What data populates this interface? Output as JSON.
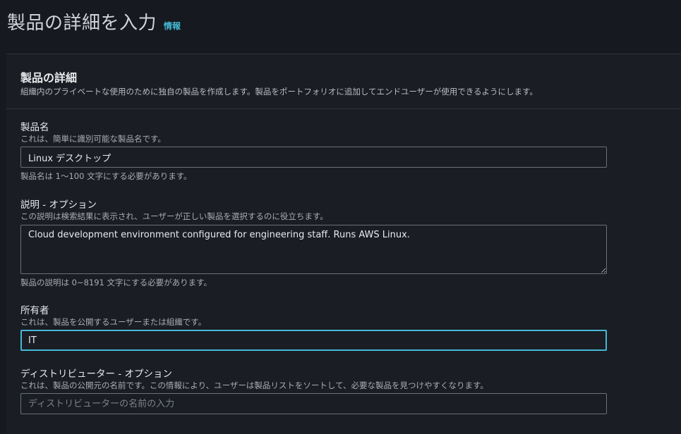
{
  "header": {
    "title": "製品の詳細を入力",
    "info_link": "情報"
  },
  "section": {
    "title": "製品の詳細",
    "description": "組織内のプライベートな使用のために独自の製品を作成します。製品をポートフォリオに追加してエンドユーザーが使用できるようにします。"
  },
  "fields": {
    "product_name": {
      "label": "製品名",
      "description": "これは、簡単に識別可能な製品名です。",
      "value": "Linux デスクトップ",
      "constraint": "製品名は 1～100 文字にする必要があります。"
    },
    "description": {
      "label": "説明 - オプション",
      "description": "この説明は検索結果に表示され、ユーザーが正しい製品を選択するのに役立ちます。",
      "value": "Cloud development environment configured for engineering staff. Runs AWS Linux.",
      "constraint": "製品の説明は 0~8191 文字にする必要があります。"
    },
    "owner": {
      "label": "所有者",
      "description": "これは、製品を公開するユーザーまたは組織です。",
      "value": "IT"
    },
    "distributor": {
      "label": "ディストリビューター - オプション",
      "description": "これは、製品の公開元の名前です。この情報により、ユーザーは製品リストをソートして、必要な製品を見つけやすくなります。",
      "placeholder": "ディストリビューターの名前の入力",
      "value": ""
    }
  },
  "colors": {
    "background": "#16191f",
    "panel": "#1a1d23",
    "accent": "#44b9d6",
    "border": "#6b7079"
  }
}
